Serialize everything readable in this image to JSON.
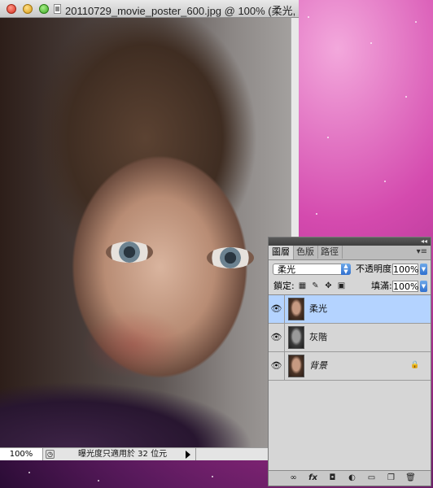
{
  "document": {
    "title": "20110729_movie_poster_600.jpg @ 100% (柔光,",
    "zoom": "100%",
    "status_text": "曝光度只適用於 32 位元"
  },
  "panel": {
    "tabs": [
      {
        "label": "圖層",
        "active": true
      },
      {
        "label": "色版",
        "active": false
      },
      {
        "label": "路徑",
        "active": false
      }
    ],
    "blend_mode": "柔光",
    "opacity_label": "不透明度:",
    "opacity_value": "100%",
    "lock_label": "鎖定:",
    "fill_label": "填滿:",
    "fill_value": "100%",
    "layers": [
      {
        "name": "柔光",
        "selected": true,
        "thumb": "color",
        "locked": false
      },
      {
        "name": "灰階",
        "selected": false,
        "thumb": "gray",
        "locked": false
      },
      {
        "name": "背景",
        "selected": false,
        "thumb": "color",
        "locked": true,
        "italic": true
      }
    ]
  },
  "icons": {
    "visibility": "eye-icon",
    "lock": "lock-icon",
    "link": "link-icon",
    "fx": "fx-icon",
    "mask": "mask-icon",
    "adjustment": "adjustment-icon",
    "folder": "folder-icon",
    "new_layer": "new-layer-icon",
    "trash": "trash-icon"
  },
  "colors": {
    "selection": "#b4d3ff",
    "accent": "#2f6fcf"
  }
}
